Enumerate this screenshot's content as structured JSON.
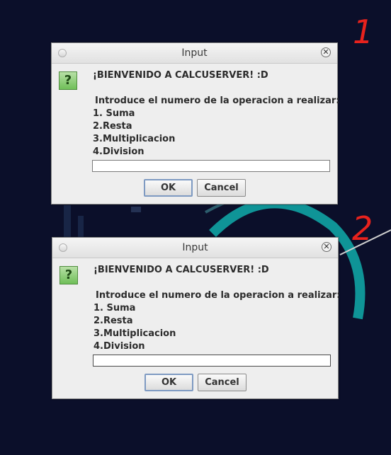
{
  "annotations": [
    "1",
    "2"
  ],
  "dialogs": [
    {
      "title": "Input",
      "greeting": "¡BIENVENIDO A CALCUSERVER! :D",
      "prompt": "Introduce el numero de la operacion a realizar:",
      "options": [
        "1. Suma",
        "2.Resta",
        "3.Multiplicacion",
        "4.Division"
      ],
      "input_value": "",
      "ok_label": "OK",
      "cancel_label": "Cancel",
      "icon": "question-icon",
      "close_glyph": "✕"
    },
    {
      "title": "Input",
      "greeting": "¡BIENVENIDO A CALCUSERVER! :D",
      "prompt": "Introduce el numero de la operacion a realizar:",
      "options": [
        "1. Suma",
        "2.Resta",
        "3.Multiplicacion",
        "4.Division"
      ],
      "input_value": "",
      "ok_label": "OK",
      "cancel_label": "Cancel",
      "icon": "question-icon",
      "close_glyph": "✕"
    }
  ],
  "colors": {
    "desktop_bg": "#0b0f2a",
    "accent_teal": "#0fa3a3",
    "annotation_red": "#e8221d"
  }
}
